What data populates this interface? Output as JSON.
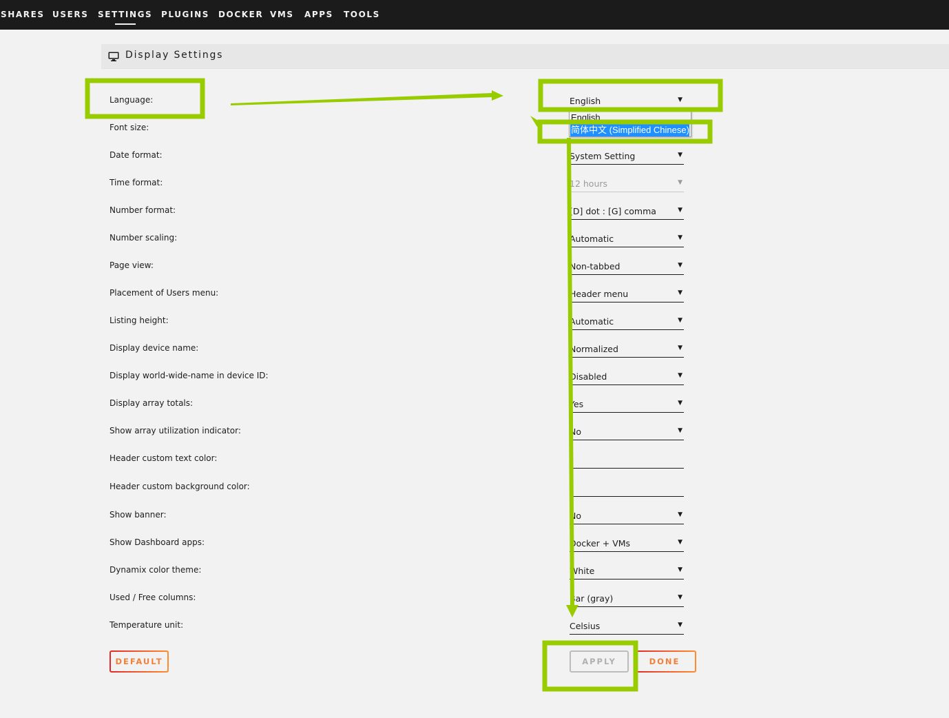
{
  "nav": {
    "items": [
      {
        "label": "SHARES",
        "active": false
      },
      {
        "label": "USERS",
        "active": false
      },
      {
        "label": "SETTINGS",
        "active": true
      },
      {
        "label": "PLUGINS",
        "active": false
      },
      {
        "label": "DOCKER",
        "active": false
      },
      {
        "label": "VMS",
        "active": false
      },
      {
        "label": "APPS",
        "active": false
      },
      {
        "label": "TOOLS",
        "active": false
      }
    ]
  },
  "section": {
    "icon": "monitor-icon",
    "title": "Display Settings"
  },
  "settings": [
    {
      "label": "Language:",
      "type": "select",
      "value": "English"
    },
    {
      "label": "Font size:",
      "type": "select",
      "value": ""
    },
    {
      "label": "Date format:",
      "type": "select",
      "value": "System Setting"
    },
    {
      "label": "Time format:",
      "type": "select",
      "value": "12 hours",
      "disabled": true
    },
    {
      "label": "Number format:",
      "type": "select",
      "value": "[D] dot : [G] comma"
    },
    {
      "label": "Number scaling:",
      "type": "select",
      "value": "Automatic"
    },
    {
      "label": "Page view:",
      "type": "select",
      "value": "Non-tabbed"
    },
    {
      "label": "Placement of Users menu:",
      "type": "select",
      "value": "Header menu"
    },
    {
      "label": "Listing height:",
      "type": "select",
      "value": "Automatic"
    },
    {
      "label": "Display device name:",
      "type": "select",
      "value": "Normalized"
    },
    {
      "label": "Display world-wide-name in device ID:",
      "type": "select",
      "value": "Disabled"
    },
    {
      "label": "Display array totals:",
      "type": "select",
      "value": "Yes"
    },
    {
      "label": "Show array utilization indicator:",
      "type": "select",
      "value": "No"
    },
    {
      "label": "Header custom text color:",
      "type": "text",
      "value": ""
    },
    {
      "label": "Header custom background color:",
      "type": "text",
      "value": ""
    },
    {
      "label": "Show banner:",
      "type": "select",
      "value": "No"
    },
    {
      "label": "Show Dashboard apps:",
      "type": "select",
      "value": "Docker + VMs"
    },
    {
      "label": "Dynamix color theme:",
      "type": "select",
      "value": "White"
    },
    {
      "label": "Used / Free columns:",
      "type": "select",
      "value": "Bar (gray)"
    },
    {
      "label": "Temperature unit:",
      "type": "select",
      "value": "Celsius"
    }
  ],
  "language_dropdown": {
    "options": [
      {
        "label": "English",
        "selected": false
      },
      {
        "label": "简体中文 (Simplified Chinese)",
        "selected": true
      }
    ]
  },
  "buttons": {
    "default": "DEFAULT",
    "apply": "APPLY",
    "done": "DONE"
  },
  "caret_glyph": "▼",
  "annotation_color": "#99cc00"
}
